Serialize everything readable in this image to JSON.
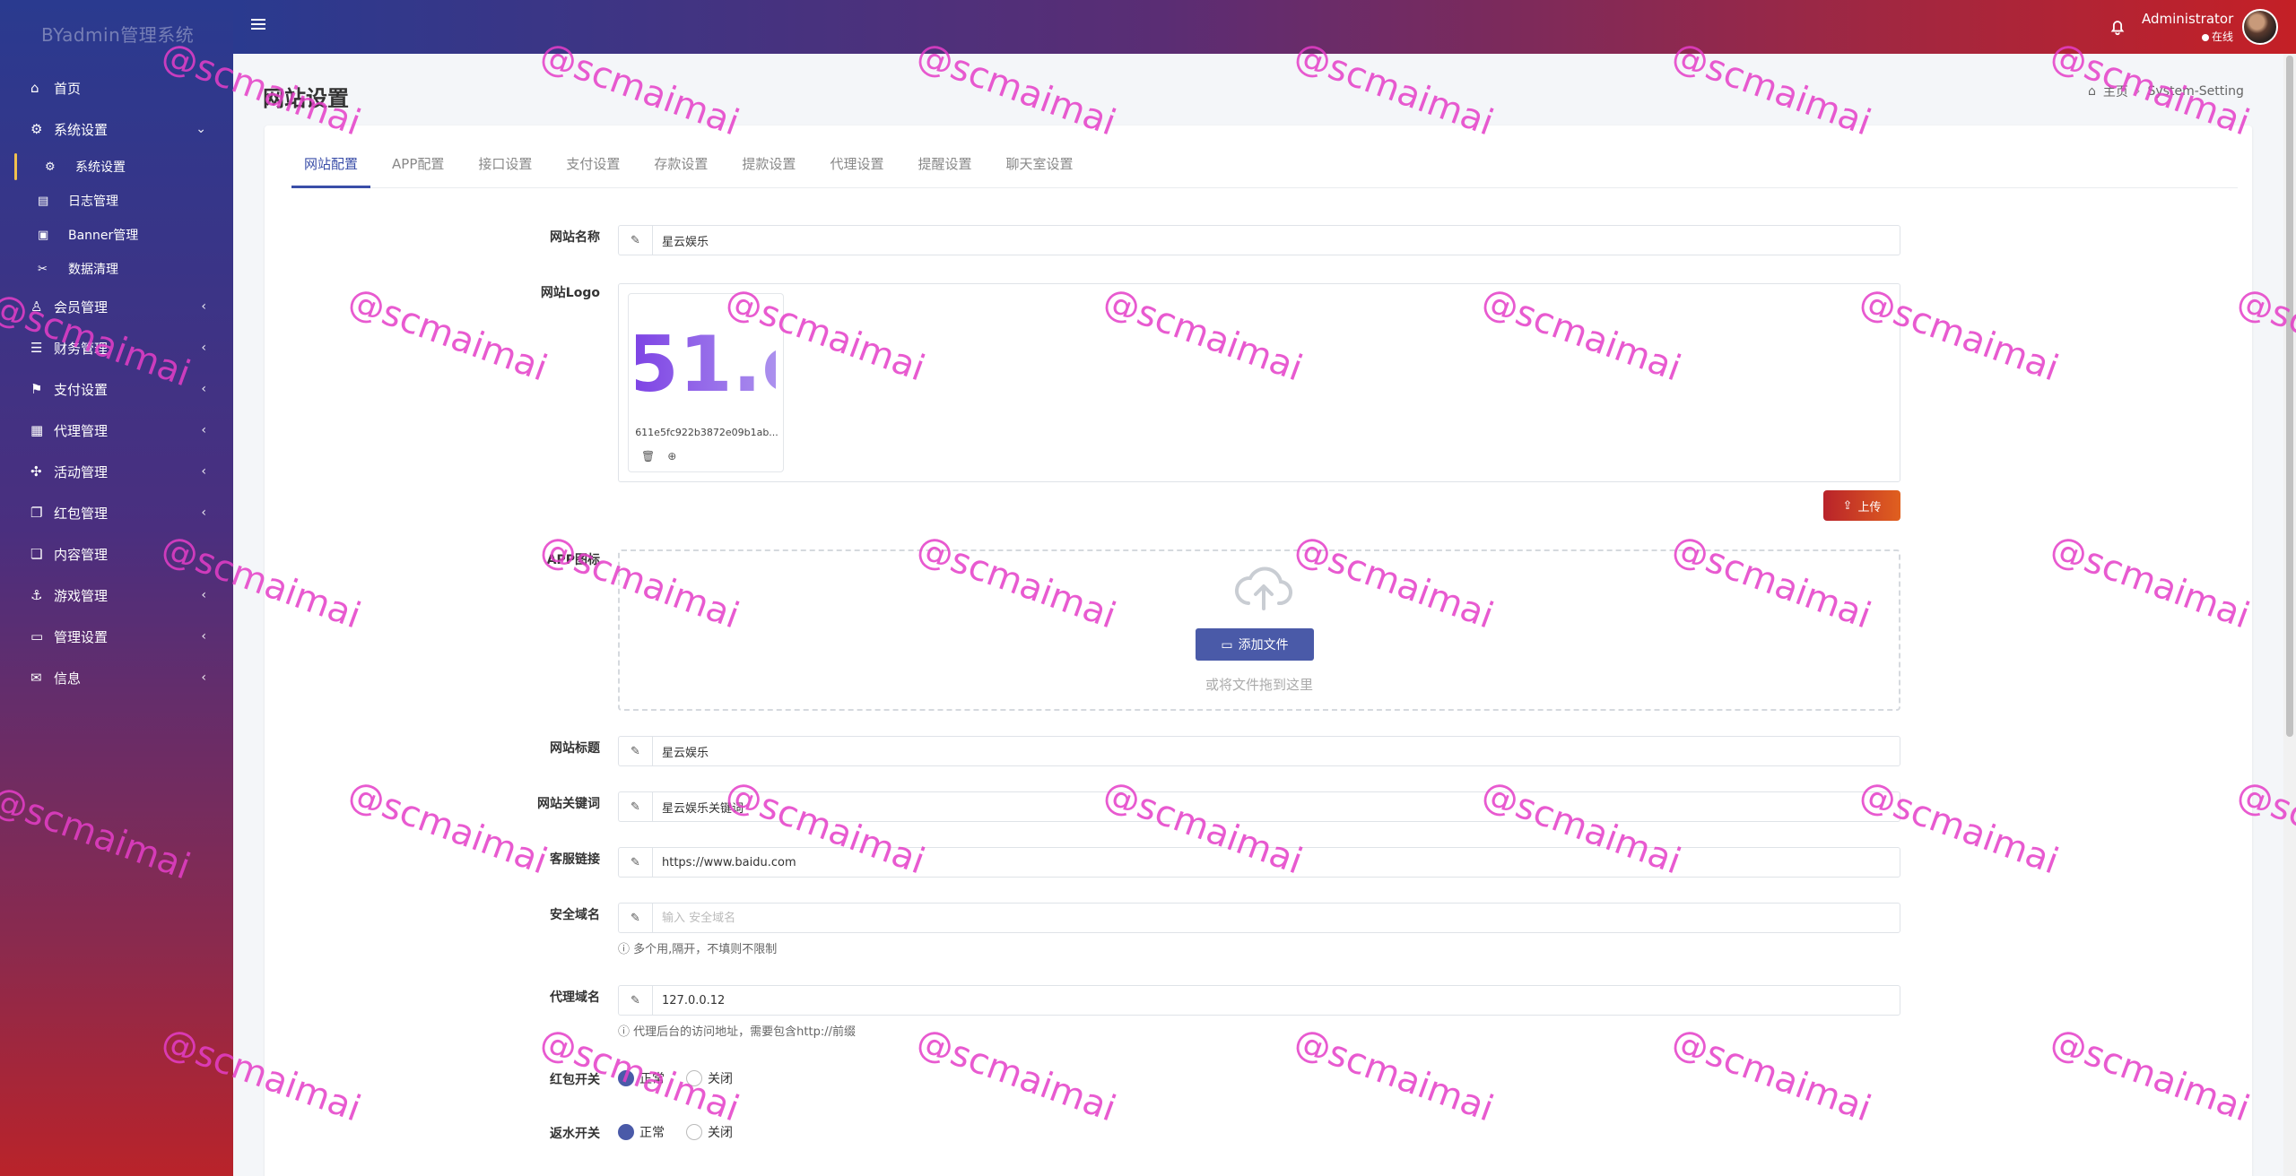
{
  "app": {
    "brand": "BYadmin管理系统"
  },
  "sidebar": {
    "items": [
      {
        "label": "首页",
        "icon": "home-icon"
      },
      {
        "label": "系统设置",
        "icon": "cogs-icon",
        "expanded": true
      },
      {
        "label": "会员管理",
        "icon": "user-icon"
      },
      {
        "label": "财务管理",
        "icon": "database-icon"
      },
      {
        "label": "支付设置",
        "icon": "bookmark-icon"
      },
      {
        "label": "代理管理",
        "icon": "image-icon"
      },
      {
        "label": "活动管理",
        "icon": "puzzle-icon"
      },
      {
        "label": "红包管理",
        "icon": "gift-icon"
      },
      {
        "label": "内容管理",
        "icon": "copy-icon"
      },
      {
        "label": "游戏管理",
        "icon": "anchor-icon"
      },
      {
        "label": "管理设置",
        "icon": "id-card-icon"
      },
      {
        "label": "信息",
        "icon": "comments-icon"
      }
    ],
    "subitems": [
      {
        "label": "系统设置",
        "icon": "gear-icon",
        "active": true
      },
      {
        "label": "日志管理",
        "icon": "file-icon"
      },
      {
        "label": "Banner管理",
        "icon": "picture-icon"
      },
      {
        "label": "数据清理",
        "icon": "scissors-icon"
      }
    ]
  },
  "topbar": {
    "user_name": "Administrator",
    "user_status": "在线"
  },
  "page": {
    "title": "网站设置",
    "breadcrumb_home": "主页",
    "breadcrumb_current": "System-Setting"
  },
  "tabs": [
    "网站配置",
    "APP配置",
    "接口设置",
    "支付设置",
    "存款设置",
    "提款设置",
    "代理设置",
    "提醒设置",
    "聊天室设置"
  ],
  "form": {
    "site_name": {
      "label": "网站名称",
      "value": "星云娱乐"
    },
    "site_logo": {
      "label": "网站Logo",
      "file_name": "611e5fc922b3872e09b1ab...",
      "logo_text": "51.c"
    },
    "upload_button": "上传",
    "app_icon": {
      "label": "APP图标",
      "add_button": "添加文件",
      "drop_hint": "或将文件拖到这里"
    },
    "site_title": {
      "label": "网站标题",
      "value": "星云娱乐"
    },
    "site_keywords": {
      "label": "网站关键词",
      "value": "星云娱乐关键词"
    },
    "service_link": {
      "label": "客服链接",
      "value": "https://www.baidu.com"
    },
    "safe_domain": {
      "label": "安全域名",
      "placeholder": "输入 安全域名",
      "help": "多个用,隔开，不填则不限制"
    },
    "agent_domain": {
      "label": "代理域名",
      "value": "127.0.0.12",
      "help": "代理后台的访问地址，需要包含http://前缀"
    },
    "redpacket_switch": {
      "label": "红包开关",
      "on": "正常",
      "off": "关闭"
    },
    "rebate_switch": {
      "label": "返水开关",
      "on": "正常",
      "off": "关闭"
    }
  },
  "watermark": "@scmaimai",
  "colors": {
    "accent": "#3a4ea8",
    "upload": "#c4342b",
    "watermark": "#e53ec8"
  }
}
